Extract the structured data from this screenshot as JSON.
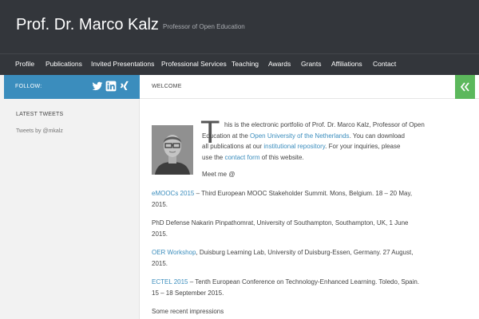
{
  "header": {
    "title": "Prof. Dr. Marco Kalz",
    "tagline": "Professor of Open Education"
  },
  "nav": {
    "items": [
      "Profile",
      "Publications",
      "Invited Presentations",
      "Professional Services",
      "Teaching",
      "Awards",
      "Grants",
      "Affiliations",
      "Contact"
    ]
  },
  "sidebar": {
    "follow_label": "FOLLOW:",
    "social_icons": [
      "twitter-icon",
      "linkedin-icon",
      "xing-icon"
    ],
    "latest_tweets_title": "LATEST TWEETS",
    "tweets_link": "Tweets by @mkalz"
  },
  "content": {
    "heading": "WELCOME",
    "intro": {
      "dropcap": "T",
      "l1": "his is the electronic portfolio of Prof. Dr. Marco Kalz, Professor of Open",
      "l2a": "Education at the ",
      "l2link": "Open University of the Netherlands",
      "l2b": ". You can download",
      "l3a": "all publications at our ",
      "l3link": "institutional repository",
      "l3b": ". For your inquiries, please",
      "l4a": "use the ",
      "l4link": "contact form",
      "l4b": " of this website."
    },
    "meet": "Meet me @",
    "events": [
      {
        "link": "eMOOCs 2015",
        "l1": " – Third European MOOC Stakeholder Summit. Mons, Belgium. 18 – 20 May,",
        "l2": "2015."
      },
      {
        "link": "",
        "l1": "PhD Defense Nakarin Pinpathomrat, University of Southampton, Southampton, UK, 1 June",
        "l2": "2015."
      },
      {
        "link": "OER Workshop",
        "l1": ", Duisburg Learning Lab, University of Duisburg-Essen, Germany. 27 August,",
        "l2": "2015."
      },
      {
        "link": "ECTEL 2015",
        "l1": " – Tenth European Conference on Technology-Enhanced Learning. Toledo, Spain.",
        "l2": "15 – 18 September 2015."
      }
    ],
    "recent": "Some recent impressions"
  },
  "colors": {
    "header_bg": "#33363b",
    "follow_bg": "#3b8dbd",
    "link": "#3b8dbd",
    "collapse_bg": "#5cb85c"
  }
}
